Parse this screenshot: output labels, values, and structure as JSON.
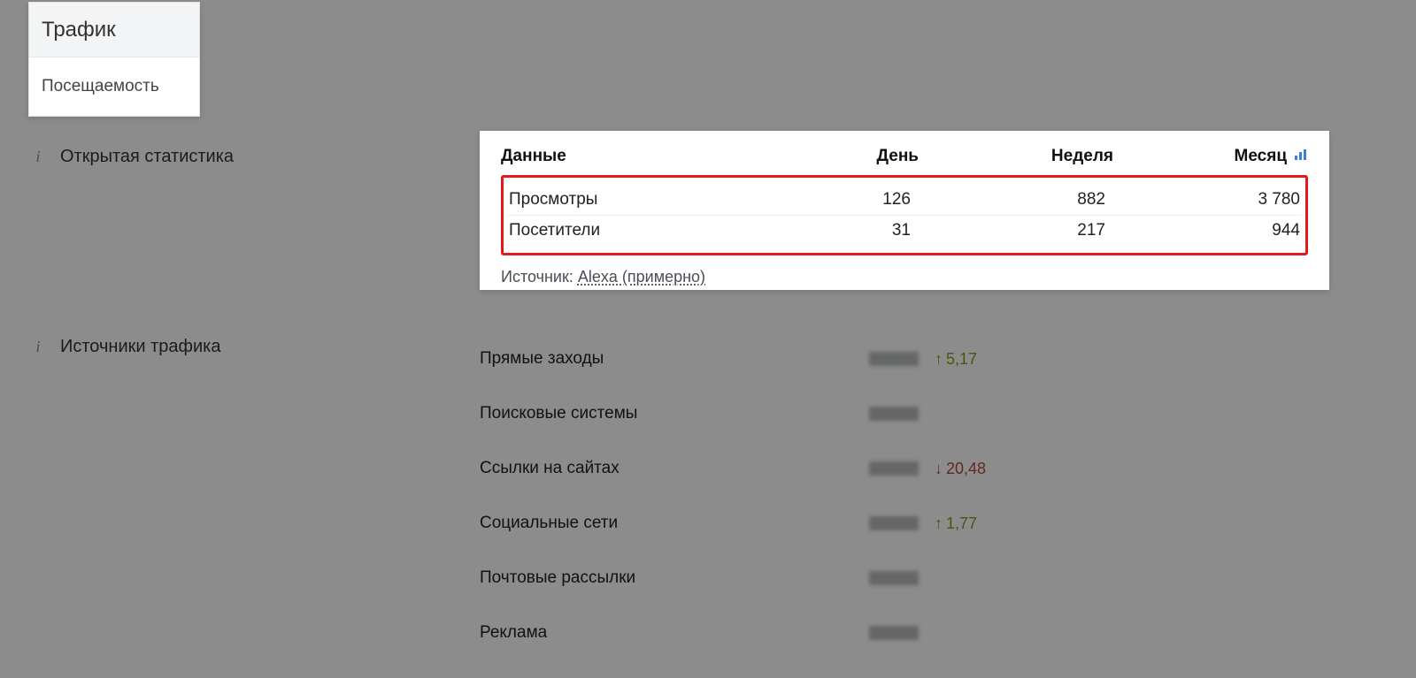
{
  "popout": {
    "title": "Трафик",
    "subitem": "Посещаемость"
  },
  "sections": {
    "open_stats_label": "Открытая статистика",
    "traffic_sources_label": "Источники трафика"
  },
  "stats": {
    "columns": {
      "data": "Данные",
      "day": "День",
      "week": "Неделя",
      "month": "Месяц"
    },
    "rows": [
      {
        "label": "Просмотры",
        "day": "126",
        "week": "882",
        "month": "3 780"
      },
      {
        "label": "Посетители",
        "day": "31",
        "week": "217",
        "month": "944"
      }
    ],
    "source_prefix": "Источник: ",
    "source_link": "Alexa (примерно)"
  },
  "traffic_sources": [
    {
      "label": "Прямые заходы",
      "delta": "5,17",
      "dir": "up"
    },
    {
      "label": "Поисковые системы",
      "delta": "",
      "dir": ""
    },
    {
      "label": "Ссылки на сайтах",
      "delta": "20,48",
      "dir": "down"
    },
    {
      "label": "Социальные сети",
      "delta": "1,77",
      "dir": "up"
    },
    {
      "label": "Почтовые рассылки",
      "delta": "",
      "dir": ""
    },
    {
      "label": "Реклама",
      "delta": "",
      "dir": ""
    }
  ]
}
